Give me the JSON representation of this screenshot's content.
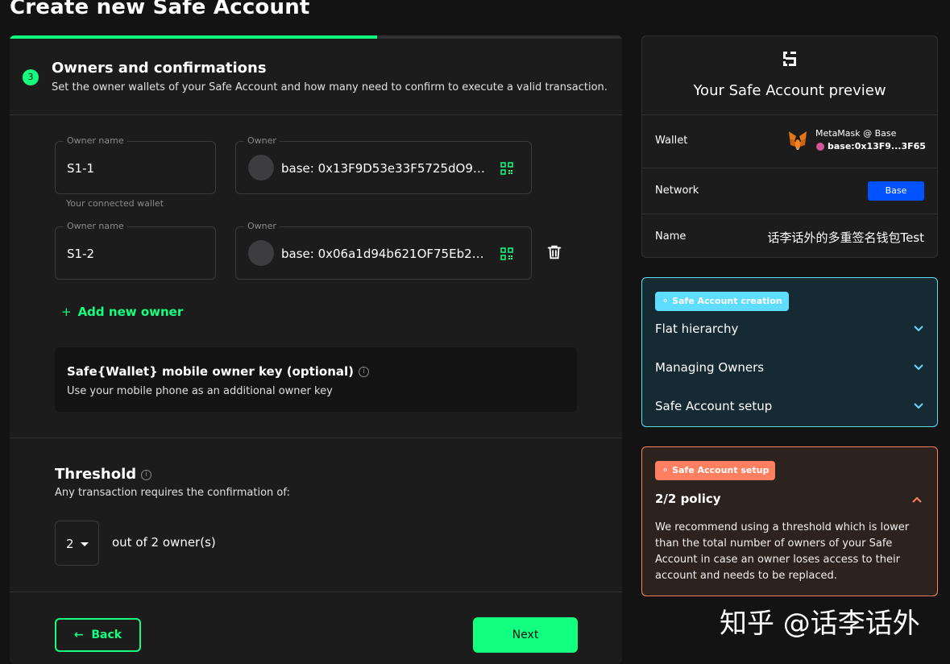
{
  "page": {
    "title": "Create new Safe Account"
  },
  "progress": {
    "fraction": 0.6
  },
  "step": {
    "number": "3",
    "title": "Owners and confirmations",
    "subtitle": "Set the owner wallets of your Safe Account and how many need to confirm to execute a valid transaction."
  },
  "owners": [
    {
      "name_label": "Owner name",
      "name": "S1-1",
      "owner_label": "Owner",
      "address": "base: 0x13F9D53e33F5725dO96...",
      "helper": "Your connected wallet"
    },
    {
      "name_label": "Owner name",
      "name": "S1-2",
      "owner_label": "Owner",
      "address": "base: 0x06a1d94b621OF75Eb241..."
    }
  ],
  "add_owner_label": "Add new owner",
  "mobile_key": {
    "title": "Safe{Wallet} mobile owner key (optional)",
    "info_glyph": "i",
    "description": "Use your mobile phone as an additional owner key"
  },
  "threshold": {
    "title": "Threshold",
    "info_glyph": "i",
    "description": "Any transaction requires the confirmation of:",
    "value": "2",
    "suffix": "out of 2 owner(s)"
  },
  "buttons": {
    "back": "Back",
    "next": "Next",
    "back_arrow": "←"
  },
  "preview": {
    "title": "Your Safe Account preview",
    "wallet_label": "Wallet",
    "wallet_name": "MetaMask @ Base",
    "wallet_address": "base:0x13F9...3F65",
    "network_label": "Network",
    "network_value": "Base",
    "name_label": "Name",
    "name_value": "话李话外的多重签名钱包Test"
  },
  "tips": {
    "badge": "Safe Account creation",
    "items": [
      {
        "label": "Flat hierarchy"
      },
      {
        "label": "Managing Owners"
      },
      {
        "label": "Safe Account setup"
      }
    ]
  },
  "setup_tip": {
    "badge": "Safe Account setup",
    "title": "2/2 policy",
    "description": "We recommend using a threshold which is lower than the total number of owners of your Safe Account in case an owner loses access to their account and needs to be replaced."
  },
  "watermark": "知乎 @话李话外",
  "colors": {
    "accent": "#12ff80",
    "background": "#121312",
    "card": "#1c1c1c",
    "info_border": "#5fddff",
    "warning_border": "#ff8061",
    "network_badge": "#0052ff"
  }
}
